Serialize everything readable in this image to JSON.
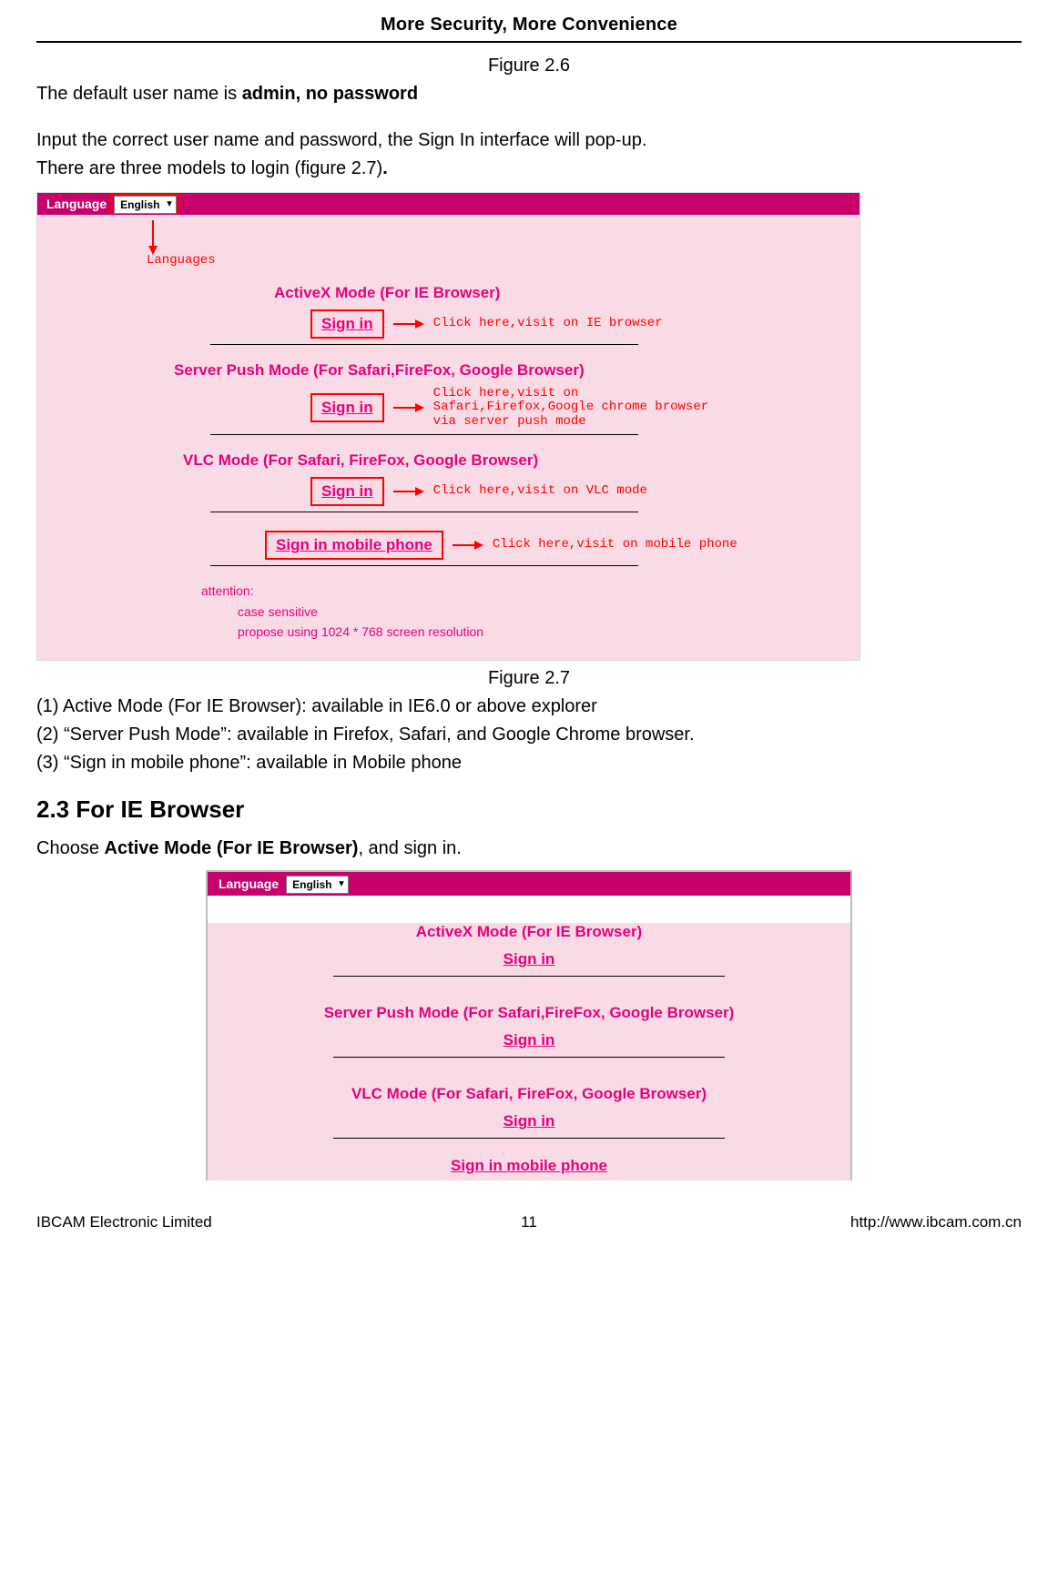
{
  "header": {
    "title": "More Security, More Convenience"
  },
  "captions": {
    "fig26": "Figure 2.6",
    "fig27": "Figure 2.7"
  },
  "text": {
    "line1_pre": "The default user name is ",
    "line1_bold": "admin, no password",
    "line2": "Input the correct user name and password, the Sign In interface will pop-up.",
    "line3_pre": "There are three models to login (figure 2.7)",
    "line3_bold_dot": ".",
    "mode1": "(1) Active Mode (For IE Browser): available in IE6.0 or above explorer",
    "mode2": "(2) “Server Push Mode”: available in Firefox, Safari, and Google Chrome browser.",
    "mode3": "(3) “Sign in mobile phone”: available in Mobile phone",
    "section": "2.3 For IE Browser",
    "choose_pre": "Choose ",
    "choose_bold": "Active Mode (For IE Browser)",
    "choose_post": ", and sign in."
  },
  "fig_annotated": {
    "language_label": "Language",
    "language_value": "English",
    "callout_languages": "Languages",
    "mode_activex": "ActiveX Mode (For IE Browser)",
    "mode_serverpush": "Server Push Mode (For Safari,FireFox, Google Browser)",
    "mode_vlc": "VLC Mode (For Safari, FireFox, Google Browser)",
    "signin": "Sign in",
    "signin_mobile": "Sign in mobile phone",
    "callout_ie": "Click here,visit on IE browser",
    "callout_push": "Click here,visit on\nSafari,Firefox,Google chrome browser\nvia server push mode",
    "callout_vlc": "Click here,visit on VLC mode",
    "callout_mobile": "Click here,visit on mobile phone",
    "attention_label": "attention:",
    "attention_line1": "case sensitive",
    "attention_line2": "propose using 1024 * 768 screen resolution"
  },
  "fig_clean": {
    "language_label": "Language",
    "language_value": "English",
    "mode_activex": "ActiveX Mode (For IE Browser)",
    "mode_serverpush": "Server Push Mode (For Safari,FireFox, Google Browser)",
    "mode_vlc": "VLC Mode (For Safari, FireFox, Google Browser)",
    "signin": "Sign in",
    "signin_mobile": "Sign in mobile phone"
  },
  "footer": {
    "left": "IBCAM Electronic Limited",
    "page": "11",
    "right": "http://www.ibcam.com.cn"
  },
  "colors": {
    "magenta": "#e6007e",
    "red": "#ff0000",
    "pink_bg": "#f9dbe6"
  }
}
